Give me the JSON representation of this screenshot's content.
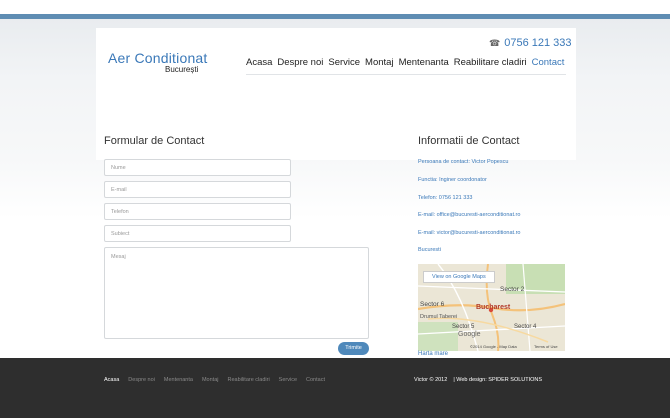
{
  "header": {
    "logo_title": "Aer Conditionat",
    "logo_subtitle": "București",
    "phone": "0756 121 333",
    "nav": [
      "Acasa",
      "Despre noi",
      "Service",
      "Montaj",
      "Mentenanta",
      "Reabilitare cladiri",
      "Contact"
    ],
    "nav_active": "Contact"
  },
  "form": {
    "title": "Formular de Contact",
    "name_placeholder": "Nume",
    "email_placeholder": "E-mail",
    "phone_placeholder": "Telefon",
    "subject_placeholder": "Subiect",
    "message_placeholder": "Mesaj",
    "submit_label": "Trimite"
  },
  "info": {
    "title": "Informatii de Contact",
    "lines": [
      "Persoana de contact: Victor Popescu",
      "Functia: Inginer coordonator",
      "Telefon: 0756 121 333",
      "E-mail: office@bucuresti-aerconditionat.ro",
      "E-mail: victor@bucuresti-aerconditionat.ro",
      "Bucuresti"
    ],
    "map_link": "Harta mare"
  },
  "map": {
    "view_button": "View on Google Maps",
    "labels": {
      "sector2": "Sector 2",
      "sector6": "Sector 6",
      "bucharest": "Bucharest",
      "drumul_taberei": "Drumul Taberei",
      "sector5": "Sector 5",
      "sector4": "Sector 4"
    },
    "credit": "©2014 Google - Map Data",
    "terms": "Terms of Use",
    "google": "Google"
  },
  "footer": {
    "nav": [
      "Acasa",
      "Despre noi",
      "Mentenanta",
      "Montaj",
      "Reabilitare cladiri",
      "Service",
      "Contact"
    ],
    "nav_active": "Acasa",
    "copyright": "Victor © 2012",
    "credit": "| Web design: SPIDER SOLUTIONS"
  },
  "colors": {
    "accent": "#3a78b8",
    "top_bar": "#5f8db3",
    "button": "#4f89bb",
    "footer_bg": "#2e2e2e"
  }
}
